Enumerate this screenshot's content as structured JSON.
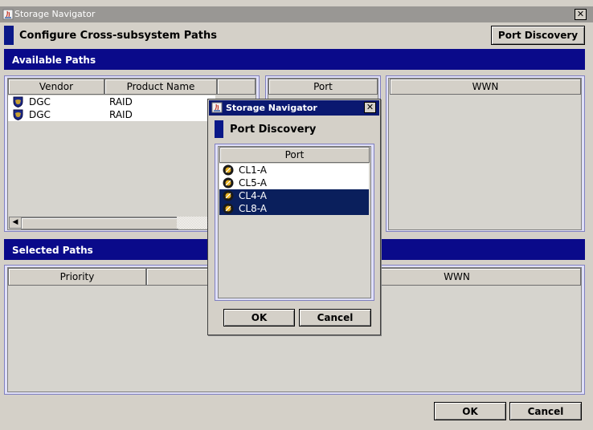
{
  "window": {
    "title": "Storage Navigator",
    "close_glyph": "✕"
  },
  "header": {
    "title": "Configure Cross-subsystem Paths",
    "port_discovery_label": "Port Discovery"
  },
  "available_paths": {
    "band_label": "Available Paths",
    "columns": {
      "vendor": "Vendor",
      "product_name": "Product Name",
      "extra": ""
    },
    "rows": [
      {
        "vendor": "DGC",
        "product_name": "RAID",
        "icon": "shield-icon"
      },
      {
        "vendor": "DGC",
        "product_name": "RAID",
        "icon": "shield-icon"
      }
    ],
    "port_column": "Port",
    "wwn_column": "WWN"
  },
  "selected_paths": {
    "band_label": "Selected Paths",
    "columns": {
      "priority": "Priority",
      "wwn": "WWN"
    }
  },
  "footer": {
    "ok_label": "OK",
    "cancel_label": "Cancel"
  },
  "dialog": {
    "title": "Storage Navigator",
    "close_glyph": "✕",
    "heading": "Port Discovery",
    "column": "Port",
    "ports": [
      {
        "label": "CL1-A",
        "selected": false,
        "icon": "port-icon"
      },
      {
        "label": "CL5-A",
        "selected": false,
        "icon": "port-icon"
      },
      {
        "label": "CL4-A",
        "selected": true,
        "icon": "port-icon"
      },
      {
        "label": "CL8-A",
        "selected": true,
        "icon": "port-icon"
      }
    ],
    "ok_label": "OK",
    "cancel_label": "Cancel"
  },
  "colors": {
    "band": "#0a0a8a",
    "dialog_title": "#0a1870",
    "selection": "#0a1f5c",
    "pane_border": "#8080c0"
  }
}
